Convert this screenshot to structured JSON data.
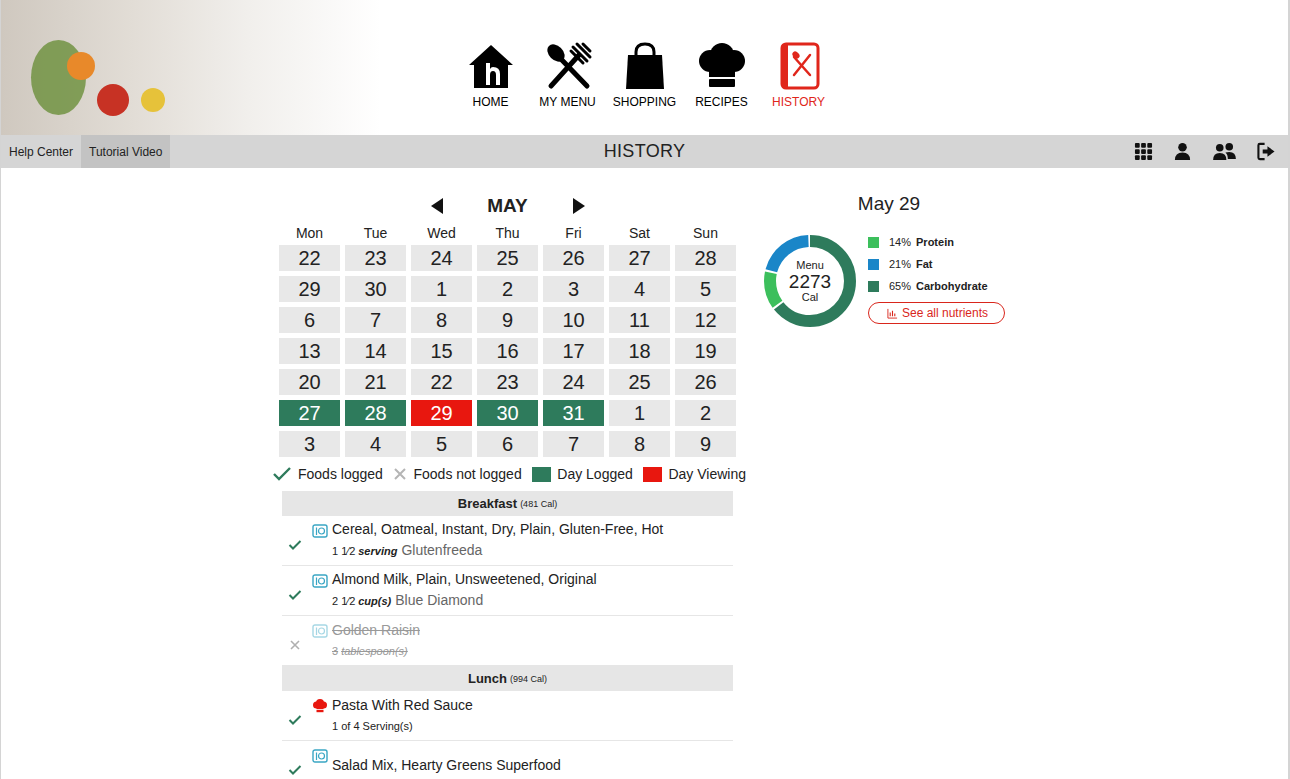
{
  "nav": [
    {
      "label": "HOME",
      "selected": false
    },
    {
      "label": "MY MENU",
      "selected": false
    },
    {
      "label": "SHOPPING",
      "selected": false
    },
    {
      "label": "RECIPES",
      "selected": false
    },
    {
      "label": "HISTORY",
      "selected": true
    }
  ],
  "toolbar": {
    "links": [
      {
        "label": "Help Center",
        "selected": false
      },
      {
        "label": "Tutorial Video",
        "selected": true
      }
    ],
    "title": "HISTORY"
  },
  "calendar": {
    "month": "MAY",
    "weekdays": [
      "Mon",
      "Tue",
      "Wed",
      "Thu",
      "Fri",
      "Sat",
      "Sun"
    ],
    "weeks": [
      [
        {
          "day": "22",
          "logged": false,
          "selected": false
        },
        {
          "day": "23",
          "logged": false,
          "selected": false
        },
        {
          "day": "24",
          "logged": false,
          "selected": false
        },
        {
          "day": "25",
          "logged": false,
          "selected": false
        },
        {
          "day": "26",
          "logged": false,
          "selected": false
        },
        {
          "day": "27",
          "logged": false,
          "selected": false
        },
        {
          "day": "28",
          "logged": false,
          "selected": false
        }
      ],
      [
        {
          "day": "29",
          "logged": false,
          "selected": false
        },
        {
          "day": "30",
          "logged": false,
          "selected": false
        },
        {
          "day": "1",
          "logged": false,
          "selected": false
        },
        {
          "day": "2",
          "logged": false,
          "selected": false
        },
        {
          "day": "3",
          "logged": false,
          "selected": false
        },
        {
          "day": "4",
          "logged": false,
          "selected": false
        },
        {
          "day": "5",
          "logged": false,
          "selected": false
        }
      ],
      [
        {
          "day": "6",
          "logged": false,
          "selected": false
        },
        {
          "day": "7",
          "logged": false,
          "selected": false
        },
        {
          "day": "8",
          "logged": false,
          "selected": false
        },
        {
          "day": "9",
          "logged": false,
          "selected": false
        },
        {
          "day": "10",
          "logged": false,
          "selected": false
        },
        {
          "day": "11",
          "logged": false,
          "selected": false
        },
        {
          "day": "12",
          "logged": false,
          "selected": false
        }
      ],
      [
        {
          "day": "13",
          "logged": false,
          "selected": false
        },
        {
          "day": "14",
          "logged": false,
          "selected": false
        },
        {
          "day": "15",
          "logged": false,
          "selected": false
        },
        {
          "day": "16",
          "logged": false,
          "selected": false
        },
        {
          "day": "17",
          "logged": false,
          "selected": false
        },
        {
          "day": "18",
          "logged": false,
          "selected": false
        },
        {
          "day": "19",
          "logged": false,
          "selected": false
        }
      ],
      [
        {
          "day": "20",
          "logged": false,
          "selected": false
        },
        {
          "day": "21",
          "logged": false,
          "selected": false
        },
        {
          "day": "22",
          "logged": false,
          "selected": false
        },
        {
          "day": "23",
          "logged": false,
          "selected": false
        },
        {
          "day": "24",
          "logged": false,
          "selected": false
        },
        {
          "day": "25",
          "logged": false,
          "selected": false
        },
        {
          "day": "26",
          "logged": false,
          "selected": false
        }
      ],
      [
        {
          "day": "27",
          "logged": true,
          "selected": false
        },
        {
          "day": "28",
          "logged": true,
          "selected": false
        },
        {
          "day": "29",
          "logged": true,
          "selected": true
        },
        {
          "day": "30",
          "logged": true,
          "selected": false
        },
        {
          "day": "31",
          "logged": true,
          "selected": false
        },
        {
          "day": "1",
          "logged": false,
          "selected": false
        },
        {
          "day": "2",
          "logged": false,
          "selected": false
        }
      ],
      [
        {
          "day": "3",
          "logged": false,
          "selected": false
        },
        {
          "day": "4",
          "logged": false,
          "selected": false
        },
        {
          "day": "5",
          "logged": false,
          "selected": false
        },
        {
          "day": "6",
          "logged": false,
          "selected": false
        },
        {
          "day": "7",
          "logged": false,
          "selected": false
        },
        {
          "day": "8",
          "logged": false,
          "selected": false
        },
        {
          "day": "9",
          "logged": false,
          "selected": false
        }
      ]
    ]
  },
  "legend": [
    {
      "label": "Foods logged",
      "kind": "check"
    },
    {
      "label": "Foods not logged",
      "kind": "cross"
    },
    {
      "label": "Day Logged",
      "kind": "swatch",
      "color": "#2e7b5c"
    },
    {
      "label": "Day Viewing",
      "kind": "swatch",
      "color": "#e8170f"
    }
  ],
  "meals": [
    {
      "title": "Breakfast",
      "calories": "(481 Cal)",
      "items": [
        {
          "name": "Cereal, Oatmeal, Instant, Dry, Plain, Gluten-Free, Hot",
          "qty": "1 1⁄2",
          "unit": "serving",
          "brand": "Glutenfreeda",
          "logged": true,
          "kind": "food"
        },
        {
          "name": "Almond Milk, Plain, Unsweetened, Original",
          "qty": "2 1⁄2",
          "unit": "cup(s)",
          "brand": "Blue Diamond",
          "logged": true,
          "kind": "food"
        },
        {
          "name": "Golden Raisin",
          "qty": "3",
          "unit": "tablespoon(s)",
          "logged": false,
          "kind": "food"
        }
      ]
    },
    {
      "title": "Lunch",
      "calories": "(994 Cal)",
      "items": [
        {
          "name": "Pasta With Red Sauce",
          "amount": "1 of 4 Serving(s)",
          "logged": true,
          "kind": "recipe"
        },
        {
          "name": "Salad Mix, Hearty Greens Superfood",
          "logged": true,
          "kind": "food"
        }
      ]
    }
  ],
  "summary": {
    "date": "May 29",
    "center_label": "Menu",
    "calories": "2273",
    "unit": "Cal",
    "nutrients": [
      {
        "percent": "14%",
        "name": "Protein",
        "level": 0.14,
        "color": "#3cbf5c"
      },
      {
        "percent": "21%",
        "name": "Fat",
        "level": 0.21,
        "color": "#1a86c8"
      },
      {
        "percent": "65%",
        "name": "Carbohydrate",
        "level": 0.65,
        "color": "#2e7b5c"
      }
    ],
    "button": "See all nutrients"
  }
}
